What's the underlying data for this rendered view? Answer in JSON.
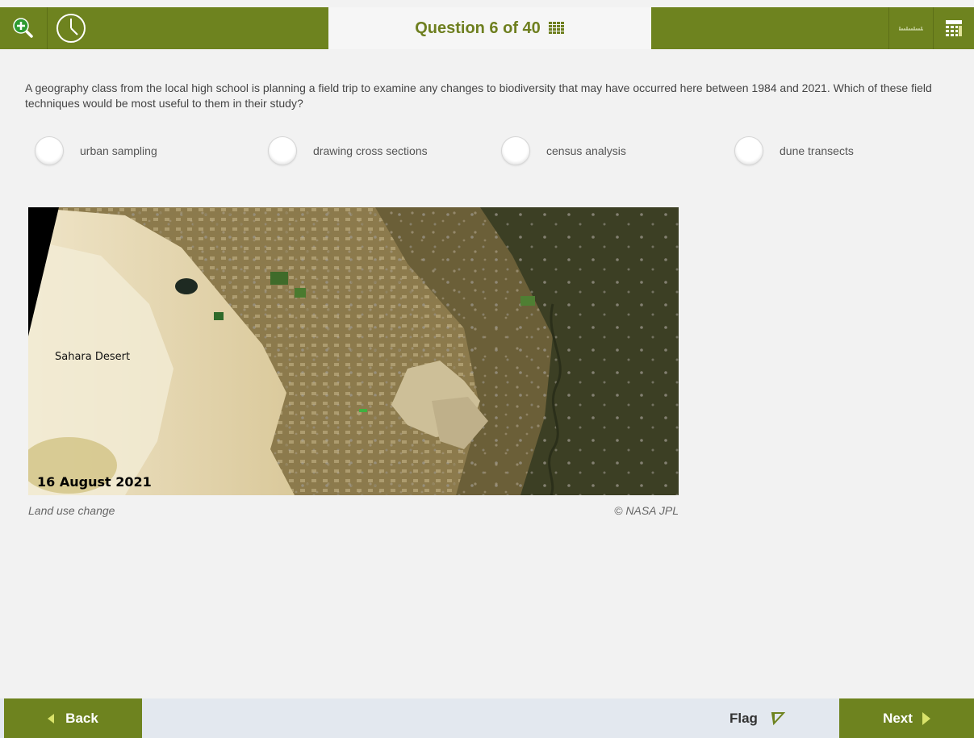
{
  "header": {
    "question_label": "Question 6 of 40",
    "icons": {
      "zoom": "zoom-in-icon",
      "timer": "clock-icon",
      "navigator": "grid-icon",
      "ruler": "ruler-icon",
      "calculator": "calculator-icon"
    }
  },
  "question": {
    "text": "A geography class from the local high school is planning a field trip to examine any changes to biodiversity that may have occurred here between 1984 and 2021. Which of these field techniques would be most useful to them in their study?",
    "options": [
      {
        "label": "urban sampling"
      },
      {
        "label": "drawing cross sections"
      },
      {
        "label": "census analysis"
      },
      {
        "label": "dune transects"
      }
    ]
  },
  "figure": {
    "region_label": "Sahara Desert",
    "date_label": "16 August 2021",
    "caption": "Land use change",
    "credit": "© NASA JPL"
  },
  "footer": {
    "back_label": "Back",
    "flag_label": "Flag",
    "next_label": "Next"
  },
  "colors": {
    "brand_green": "#6e831f",
    "title_green": "#6e7f1f",
    "footer_bg": "#e3e8ef",
    "page_bg": "#f2f2f2"
  }
}
